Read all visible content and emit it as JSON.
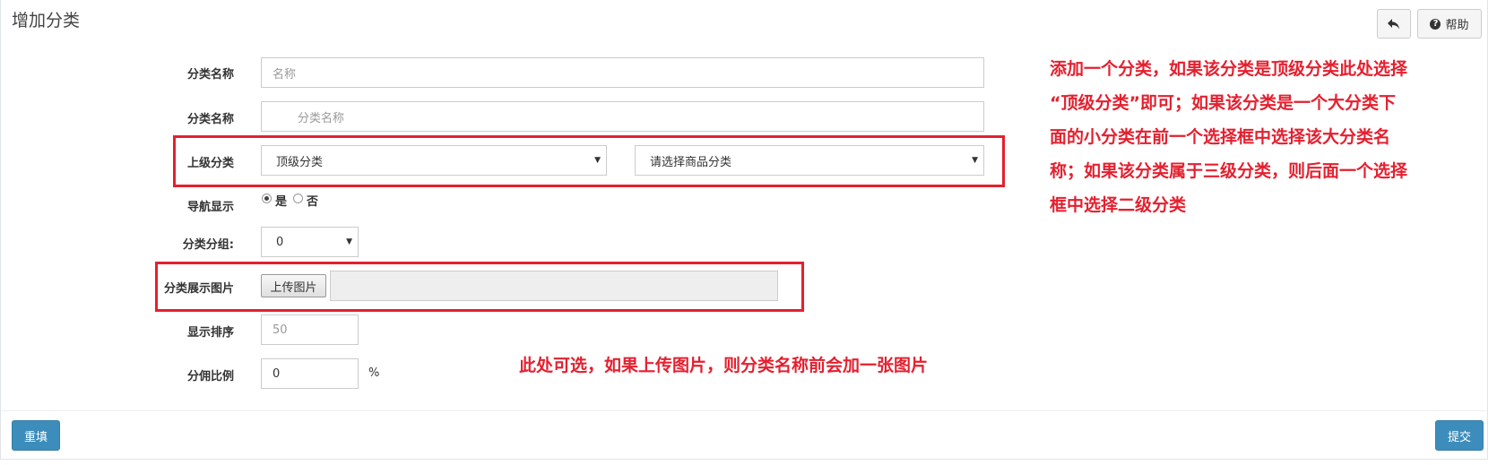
{
  "header": {
    "title": "增加分类",
    "back_icon": "reply-icon",
    "help_label": "帮助",
    "help_icon_glyph": "?"
  },
  "form": {
    "name": {
      "label": "分类名称",
      "placeholder": "名称"
    },
    "category_name": {
      "label": "分类名称",
      "placeholder": "分类名称"
    },
    "parent": {
      "label": "上级分类",
      "level1_value": "顶级分类",
      "level2_value": "请选择商品分类"
    },
    "nav_display": {
      "label": "导航显示",
      "yes": "是",
      "no": "否",
      "selected": "是"
    },
    "group": {
      "label": "分类分组:",
      "value": "0"
    },
    "image": {
      "label": "分类展示图片",
      "upload_label": "上传图片"
    },
    "sort": {
      "label": "显示排序",
      "value": "50"
    },
    "commission": {
      "label": "分佣比例",
      "value": "0",
      "unit": "%"
    }
  },
  "annotations": {
    "parent_note": [
      "添加一个分类，如果该分类是顶级分类此处选择",
      "“顶级分类”即可；如果该分类是一个大分类下",
      "面的小分类在前一个选择框中选择该大分类名",
      "称；如果该分类属于三级分类，则后面一个选择",
      "框中选择二级分类"
    ],
    "image_note": "此处可选，如果上传图片，则分类名称前会加一张图片"
  },
  "footer": {
    "reset_label": "重填",
    "submit_label": "提交"
  },
  "colors": {
    "accent": "#3c8dbc",
    "annotation": "#e4202f"
  }
}
